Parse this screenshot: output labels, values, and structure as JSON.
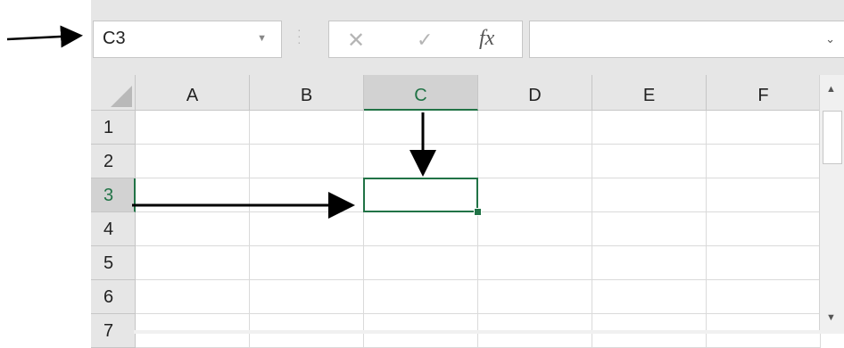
{
  "name_box": {
    "value": "C3"
  },
  "formula_bar": {
    "cancel_icon": "✕",
    "enter_icon": "✓",
    "fx_label": "fx",
    "value": ""
  },
  "columns": [
    "A",
    "B",
    "C",
    "D",
    "E",
    "F"
  ],
  "rows": [
    "1",
    "2",
    "3",
    "4",
    "5",
    "6",
    "7"
  ],
  "selected_column": "C",
  "selected_row": "3",
  "colors": {
    "accent": "#217346",
    "header_bg": "#e6e6e6"
  }
}
